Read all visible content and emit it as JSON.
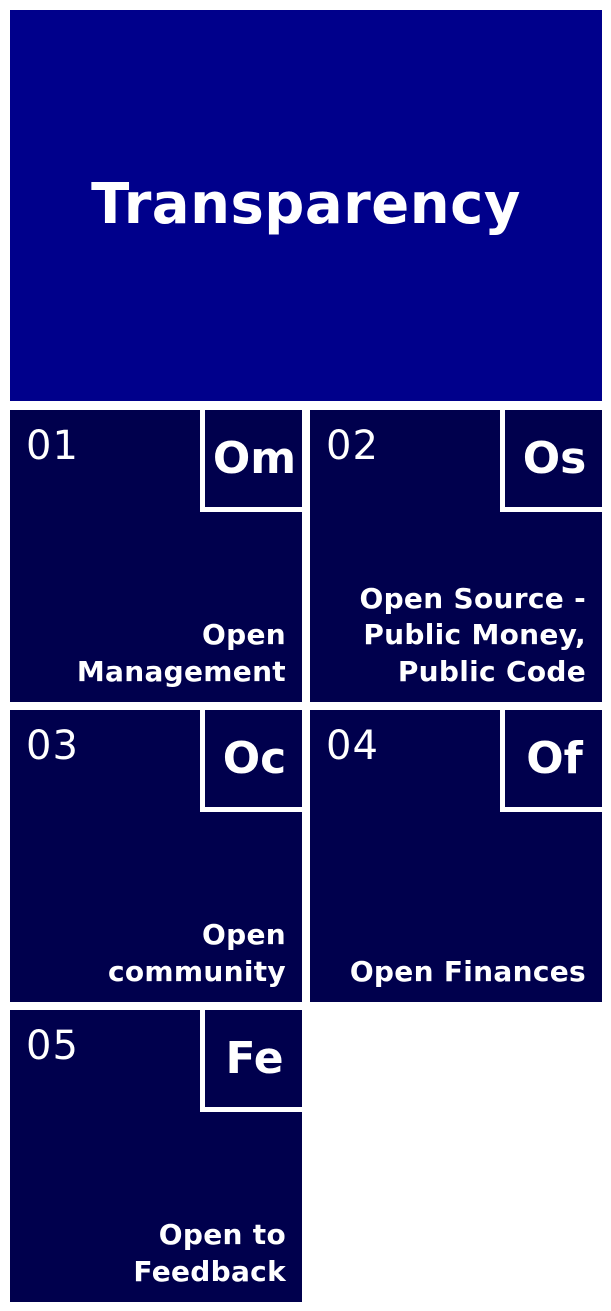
{
  "header": {
    "title": "Transparency",
    "background": "#00008b"
  },
  "tiles": [
    {
      "number": "01",
      "symbol": "Om",
      "label": "Open\nManagement"
    },
    {
      "number": "02",
      "symbol": "Os",
      "label": "Open Source -\nPublic Money,\nPublic Code"
    },
    {
      "number": "03",
      "symbol": "Oc",
      "label": "Open\ncommunity"
    },
    {
      "number": "04",
      "symbol": "Of",
      "label": "Open Finances"
    },
    {
      "number": "05",
      "symbol": "Fe",
      "label": "Open to\nFeedback"
    }
  ],
  "colors": {
    "tile_background": "#00004d",
    "text": "#ffffff",
    "page_background": "#ffffff"
  }
}
